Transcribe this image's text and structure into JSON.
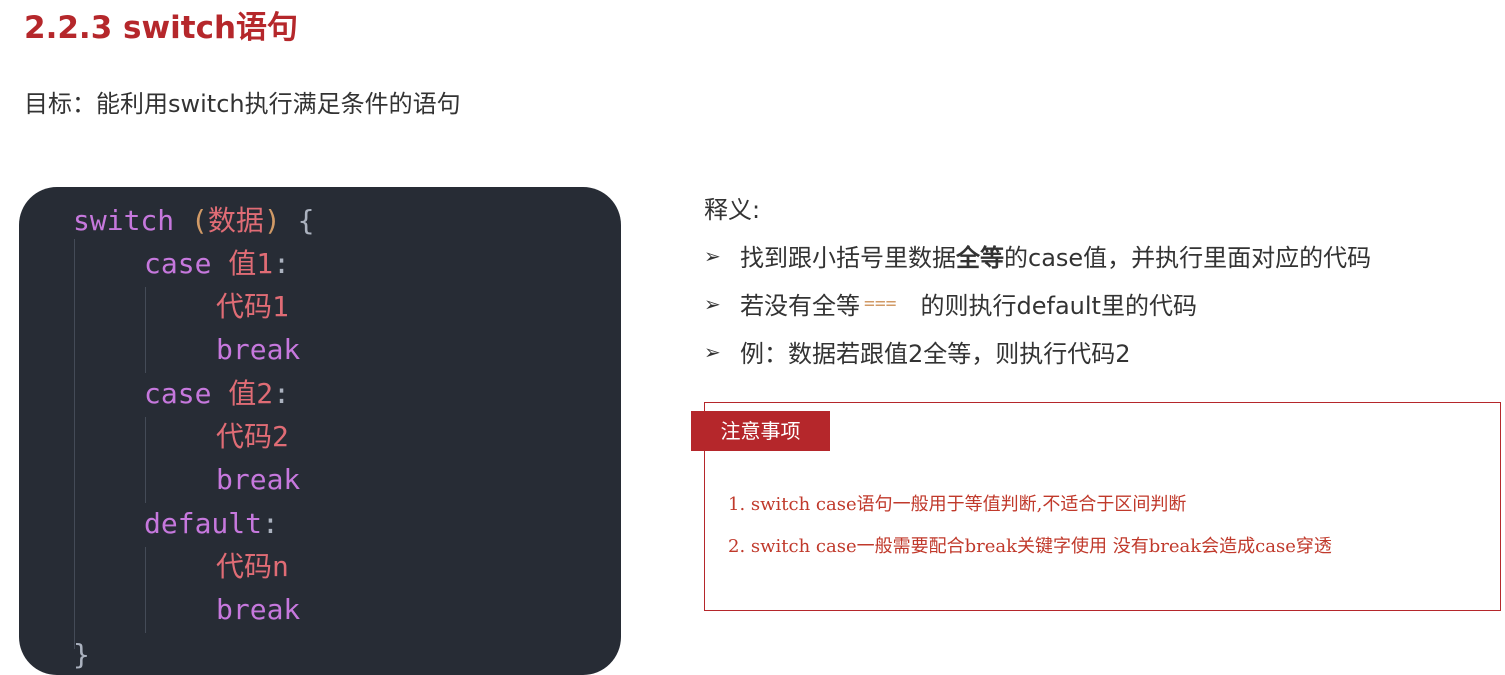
{
  "heading": {
    "title": "2.2.3  switch语句"
  },
  "goal": "目标：能利用switch执行满足条件的语句",
  "code": {
    "line1": {
      "kw": "switch",
      "open": "(",
      "arg": "数据",
      "close": ")",
      "brace": "{"
    },
    "case1": {
      "kw": "case",
      "value": "值1",
      "colon": ":"
    },
    "code1": "代码1",
    "break1": "break",
    "case2": {
      "kw": "case",
      "value": "值2",
      "colon": ":"
    },
    "code2": "代码2",
    "break2": "break",
    "default": {
      "kw": "default",
      "colon": ":"
    },
    "coden": "代码n",
    "break3": "break",
    "end": "}"
  },
  "explanation": {
    "heading": "释义:",
    "bullets": [
      {
        "before": "找到跟小括号里数据",
        "bold": "全等",
        "after": "的case值，并执行里面对应的代码"
      },
      {
        "before": "若没有全等",
        "code": "===",
        "after": "的则执行default里的代码"
      },
      {
        "text": "例：数据若跟值2全等，则执行代码2"
      }
    ]
  },
  "note": {
    "tag": "注意事项",
    "items": [
      "1.  switch case语句一般用于等值判断,不适合于区间判断",
      "2.  switch case一般需要配合break关键字使用 没有break会造成case穿透"
    ]
  },
  "colors": {
    "title": "#b5272b",
    "code_bg": "#272c35",
    "keyword": "#c678dd",
    "chinese_code": "#e06c75",
    "note_text": "#c0392b"
  }
}
